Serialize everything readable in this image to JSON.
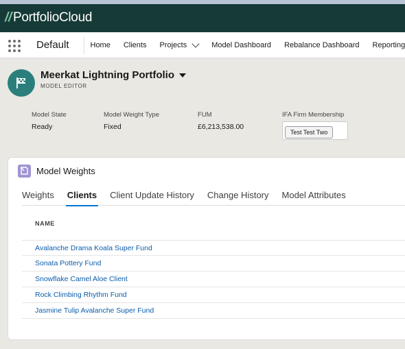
{
  "brand": {
    "slash": "//",
    "name": "PortfolioCloud"
  },
  "nav": {
    "app_name": "Default",
    "items": [
      "Home",
      "Clients",
      "Projects",
      "Model Dashboard",
      "Rebalance Dashboard",
      "Reporting"
    ]
  },
  "record": {
    "title": "Meerkat Lightning Portfolio",
    "subtitle": "MODEL EDITOR",
    "fields": [
      {
        "label": "Model State",
        "value": "Ready"
      },
      {
        "label": "Model Weight Type",
        "value": "Fixed"
      },
      {
        "label": "FUM",
        "value": "£6,213,538.00"
      },
      {
        "label": "IFA Firm Membership",
        "value": "Test Test Two"
      }
    ]
  },
  "card": {
    "title": "Model Weights",
    "tabs": [
      "Weights",
      "Clients",
      "Client Update History",
      "Change History",
      "Model Attributes"
    ],
    "active_tab": "Clients",
    "column_header": "NAME",
    "rows": [
      "Avalanche Drama Koala Super Fund",
      "Sonata Pottery Fund",
      "Snowflake Camel Aloe Client",
      "Rock Climbing Rhythm Fund",
      "Jasmine Tulip Avalanche Super Fund"
    ]
  },
  "colors": {
    "brand_bar": "#163a37",
    "accent": "#0176d3",
    "record_icon": "#2a7f7c",
    "card_icon": "#a094d2",
    "link": "#0b5cab"
  }
}
